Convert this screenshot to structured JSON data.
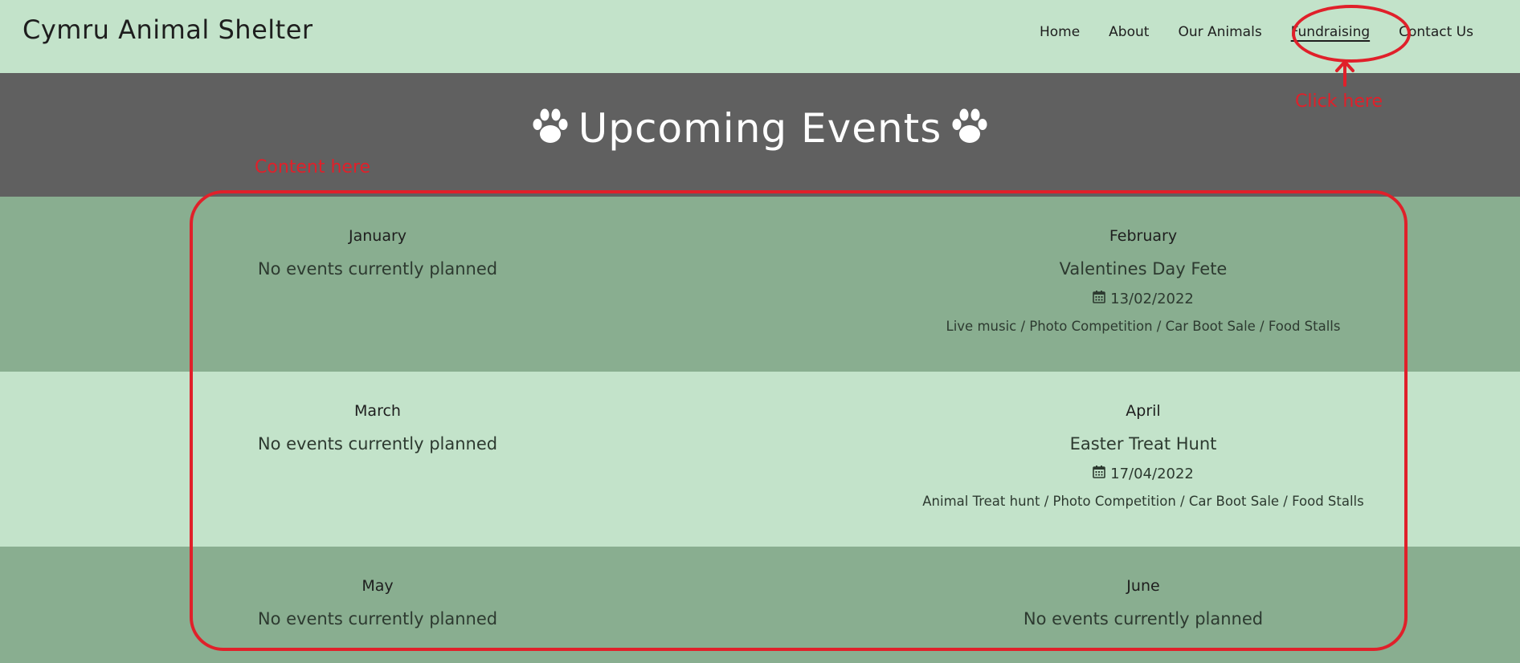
{
  "site": {
    "brand": "Cymru Animal Shelter"
  },
  "nav": {
    "items": [
      {
        "label": "Home"
      },
      {
        "label": "About"
      },
      {
        "label": "Our Animals"
      },
      {
        "label": "Fundraising"
      },
      {
        "label": "Contact Us"
      }
    ]
  },
  "hero": {
    "title": "Upcoming Events",
    "icon": "paw-icon"
  },
  "events": [
    {
      "month": "January",
      "status": "No events currently planned"
    },
    {
      "month": "February",
      "name": "Valentines Day Fete",
      "date": "13/02/2022",
      "desc": "Live music / Photo Competition / Car Boot Sale / Food Stalls"
    },
    {
      "month": "March",
      "status": "No events currently planned"
    },
    {
      "month": "April",
      "name": "Easter Treat Hunt",
      "date": "17/04/2022",
      "desc": "Animal Treat hunt / Photo Competition / Car Boot Sale / Food Stalls"
    },
    {
      "month": "May",
      "status": "No events currently planned"
    },
    {
      "month": "June",
      "status": "No events currently planned"
    }
  ],
  "annotations": {
    "click_here": "Click here",
    "content_here": "Content here"
  },
  "colors": {
    "annotation": "#e0202a",
    "nav_bg": "#c3e3ca",
    "hero_bg": "#606060",
    "band_dark": "#89ae90"
  }
}
